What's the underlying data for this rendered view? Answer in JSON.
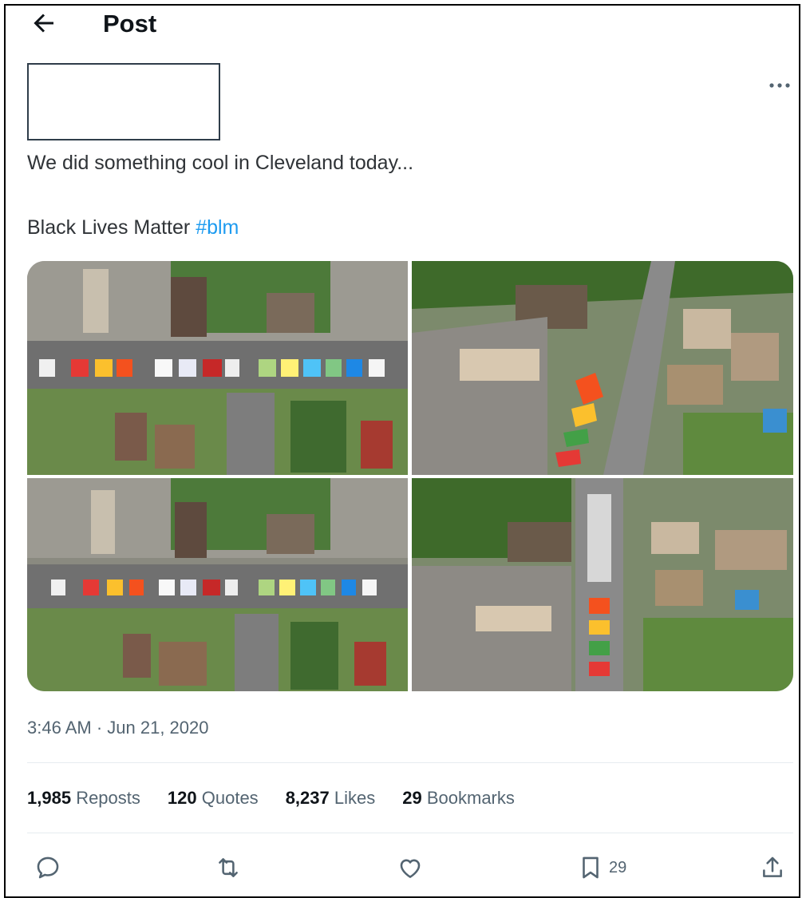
{
  "header": {
    "title": "Post"
  },
  "post": {
    "text_line1": "We did something cool in Cleveland today...",
    "text_line2_prefix": "Black Lives Matter ",
    "hashtag": "#blm",
    "timestamp": "3:46 AM · Jun 21, 2020"
  },
  "stats": {
    "reposts": {
      "count": "1,985",
      "label": "Reposts"
    },
    "quotes": {
      "count": "120",
      "label": "Quotes"
    },
    "likes": {
      "count": "8,237",
      "label": "Likes"
    },
    "bookmarks": {
      "count": "29",
      "label": "Bookmarks"
    }
  },
  "actions": {
    "bookmark_count": "29"
  },
  "icons": [
    "back-arrow-icon",
    "more-icon",
    "reply-icon",
    "repost-icon",
    "like-icon",
    "bookmark-icon",
    "share-icon"
  ],
  "colors": {
    "link": "#1d9bf0",
    "secondary_text": "#536471",
    "text": "#0f1419"
  }
}
